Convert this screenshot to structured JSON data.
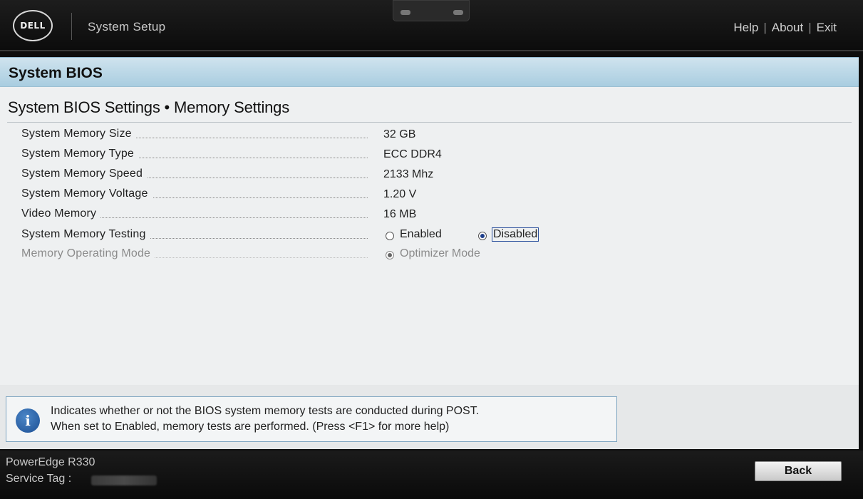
{
  "header": {
    "logo_text": "DELL",
    "app_title": "System Setup",
    "links": [
      "Help",
      "About",
      "Exit"
    ],
    "separator": "|"
  },
  "section": {
    "title": "System BIOS"
  },
  "page": {
    "title": "System BIOS Settings • Memory Settings"
  },
  "settings": [
    {
      "label": "System Memory Size",
      "value": "32 GB"
    },
    {
      "label": "System Memory Type",
      "value": "ECC DDR4"
    },
    {
      "label": "System Memory Speed",
      "value": "2133 Mhz"
    },
    {
      "label": "System Memory Voltage",
      "value": "1.20 V"
    },
    {
      "label": "Video Memory",
      "value": "16 MB"
    },
    {
      "label": "System Memory Testing",
      "options": [
        "Enabled",
        "Disabled"
      ],
      "selected": "Disabled"
    },
    {
      "label": "Memory Operating Mode",
      "options": [
        "Optimizer Mode"
      ],
      "selected": "Optimizer Mode",
      "disabled": true
    }
  ],
  "help": {
    "line1": "Indicates whether or not the BIOS system memory tests are conducted during POST.",
    "line2": "When set to Enabled, memory tests are performed. (Press <F1> for more help)",
    "icon": "info-icon"
  },
  "footer": {
    "model": "PowerEdge R330",
    "service_tag_label": "Service Tag :",
    "back_label": "Back"
  },
  "colors": {
    "section_bar": "#b9d7e7",
    "panel_bg": "#eef0f1",
    "radio_selected": "#1c3e8a",
    "help_border": "#7fa6c1"
  }
}
